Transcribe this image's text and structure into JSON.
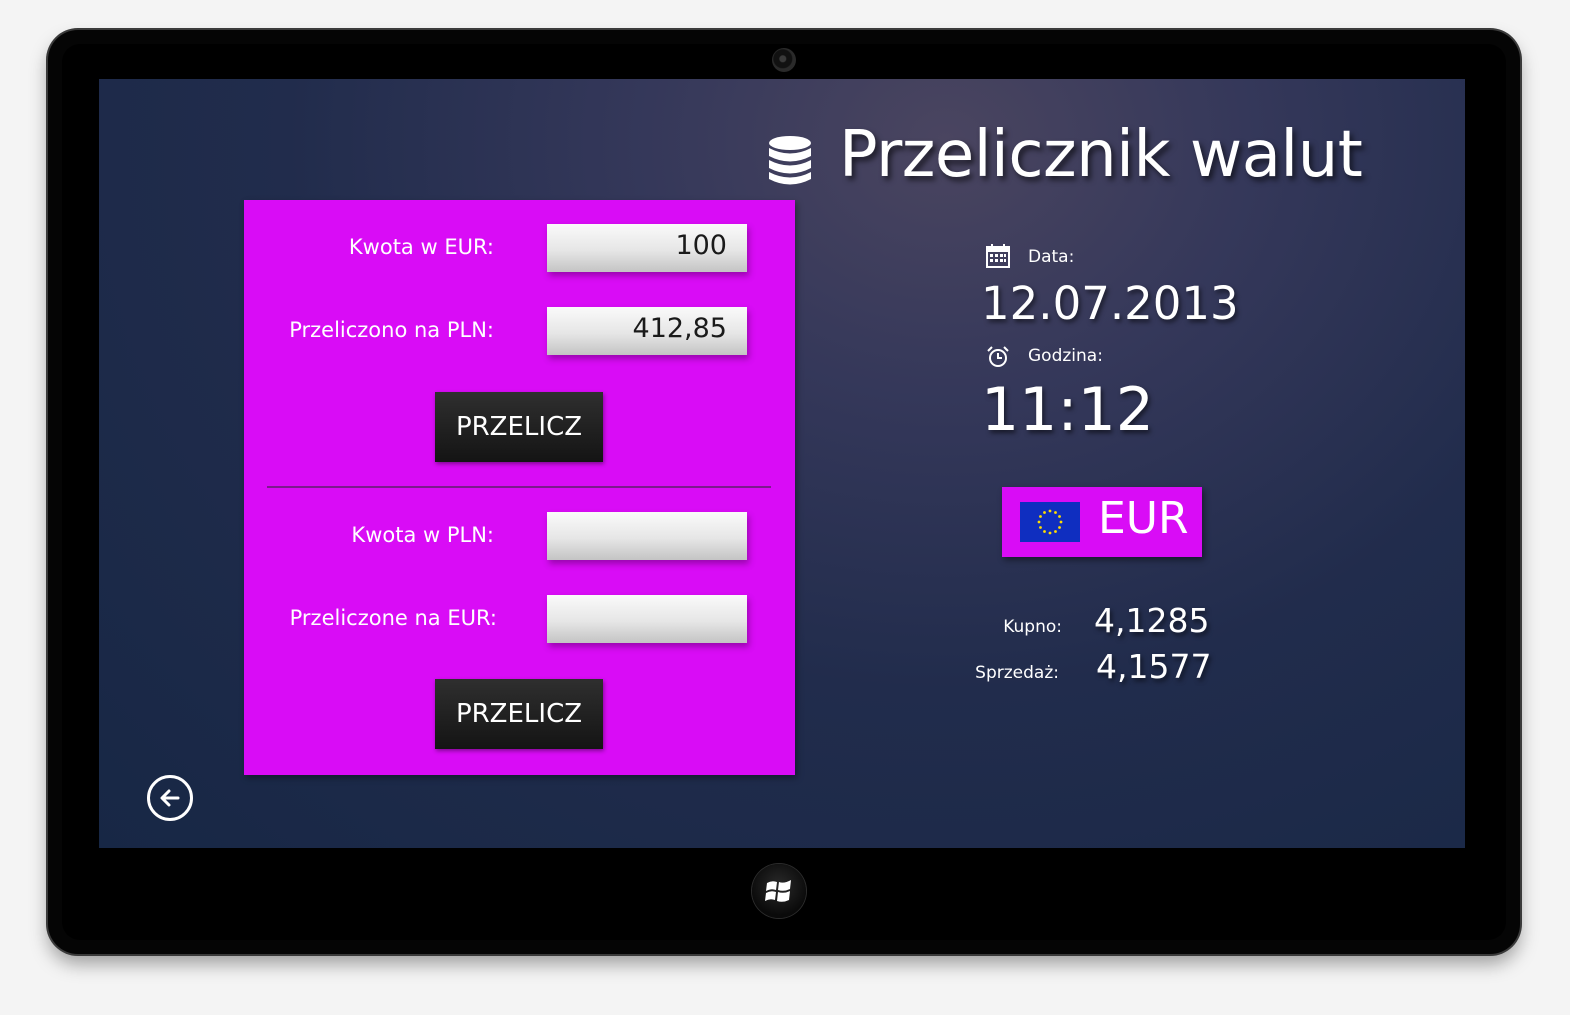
{
  "app": {
    "title": "Przelicznik walut",
    "title_icon": "database-icon"
  },
  "converter": {
    "eur_to_pln": {
      "amount_label": "Kwota w EUR:",
      "amount_value": "100",
      "result_label": "Przeliczono na PLN:",
      "result_value": "412,85",
      "button_label": "PRZELICZ"
    },
    "pln_to_eur": {
      "amount_label": "Kwota w PLN:",
      "amount_value": "",
      "result_label": "Przeliczone na EUR:",
      "result_value": "",
      "button_label": "PRZELICZ"
    }
  },
  "info": {
    "date_label": "Data:",
    "date_value": "12.07.2013",
    "date_icon": "calendar-icon",
    "time_label": "Godzina:",
    "time_value": "11:12",
    "time_icon": "alarm-clock-icon"
  },
  "currency": {
    "code": "EUR",
    "flag_icon": "eu-flag-icon",
    "buy_label": "Kupno:",
    "buy_value": "4,1285",
    "sell_label": "Sprzedaż:",
    "sell_value": "4,1577"
  },
  "navigation": {
    "back_icon": "back-arrow-icon",
    "start_icon": "windows-logo-icon"
  },
  "colors": {
    "panel": "#d90cf6",
    "button": "#1e1e1e",
    "background_dark": "#172745",
    "background_light": "#4a4560",
    "flag_blue": "#0f2ec0",
    "flag_stars": "#ffdd00"
  }
}
